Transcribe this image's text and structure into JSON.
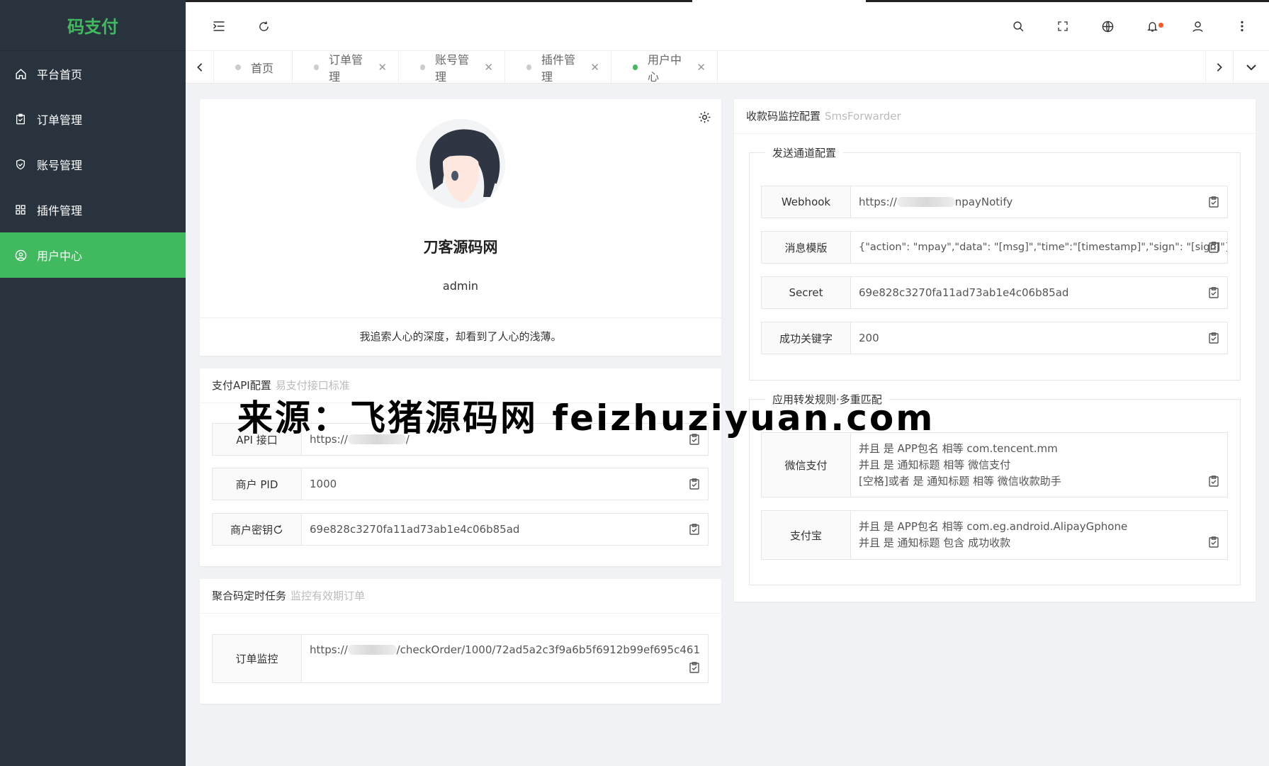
{
  "sidebar": {
    "brand": "码支付",
    "items": [
      {
        "label": "平台首页",
        "icon": "home-icon"
      },
      {
        "label": "订单管理",
        "icon": "clipboard-check-icon"
      },
      {
        "label": "账号管理",
        "icon": "shield-check-icon"
      },
      {
        "label": "插件管理",
        "icon": "grid-icon"
      },
      {
        "label": "用户中心",
        "icon": "user-circle-icon",
        "active": true
      }
    ]
  },
  "tabs": [
    {
      "label": "首页",
      "closable": false
    },
    {
      "label": "订单管理",
      "closable": true
    },
    {
      "label": "账号管理",
      "closable": true
    },
    {
      "label": "插件管理",
      "closable": true
    },
    {
      "label": "用户中心",
      "closable": true,
      "active": true
    }
  ],
  "profile": {
    "name": "刀客源码网",
    "username": "admin",
    "motto": "我追索人心的深度，却看到了人心的浅薄。"
  },
  "api_config": {
    "title": "支付API配置",
    "subtitle": "易支付接口标准",
    "rows": [
      {
        "label": "API 接口",
        "value_prefix": "https://",
        "value_suffix": "/"
      },
      {
        "label": "商户 PID",
        "value": "1000"
      },
      {
        "label": "商户密钥",
        "value": "69e828c3270fa11ad73ab1e4c06b85ad"
      }
    ]
  },
  "cron": {
    "title": "聚合码定时任务",
    "subtitle": "监控有效期订单",
    "row_label": "订单监控",
    "value_prefix": "https://",
    "value_suffix": "/checkOrder/1000/72ad5a2c3f9a6b5f6912b99ef695c461"
  },
  "monitor": {
    "title": "收款码监控配置",
    "subtitle": "SmsForwarder",
    "send_legend": "发送通道配置",
    "send_rows": [
      {
        "label": "Webhook",
        "value_prefix": "https://",
        "value_suffix": "npayNotify"
      },
      {
        "label": "消息模版",
        "value": "{\"action\": \"mpay\",\"data\": \"[msg]\",\"time\":\"[timestamp]\",\"sign\": \"[sign]\"}"
      },
      {
        "label": "Secret",
        "value": "69e828c3270fa11ad73ab1e4c06b85ad"
      },
      {
        "label": "成功关键字",
        "value": "200"
      }
    ],
    "rule_legend": "应用转发规则·多重匹配",
    "rules": [
      {
        "label": "微信支付",
        "lines": [
          "并且 是 APP包名 相等 com.tencent.mm",
          "并且 是 通知标题 相等 微信支付",
          "[空格]或者 是 通知标题 相等 微信收款助手"
        ]
      },
      {
        "label": "支付宝",
        "lines": [
          "并且 是 APP包名 相等 com.eg.android.AlipayGphone",
          "并且 是 通知标题 包含 成功收款"
        ]
      }
    ]
  },
  "watermark": "来源：飞猪源码网 feizhuziyuan.com",
  "colors": {
    "accent": "#40b95f",
    "sidebar": "#28333e",
    "badge": "#ff5722"
  }
}
